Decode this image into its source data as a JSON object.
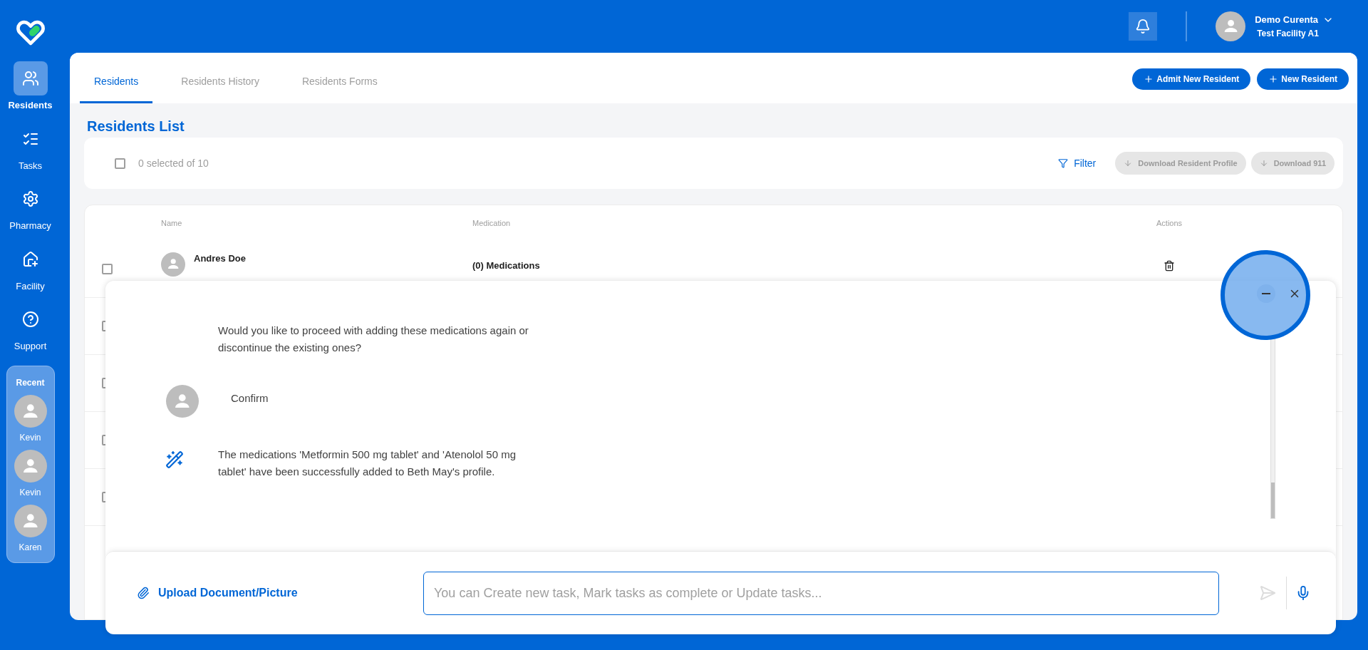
{
  "sidebar": {
    "items": [
      {
        "label": "Residents",
        "selected": true
      },
      {
        "label": "Tasks",
        "selected": false
      },
      {
        "label": "Pharmacy",
        "selected": false
      },
      {
        "label": "Facility",
        "selected": false
      },
      {
        "label": "Support",
        "selected": false
      }
    ],
    "recent": {
      "title": "Recent",
      "people": [
        "Kevin",
        "Kevin",
        "Karen"
      ]
    }
  },
  "header": {
    "user": {
      "name": "Demo Curenta",
      "facility": "Test Facility A1"
    }
  },
  "tabs": [
    {
      "label": "Residents",
      "selected": true
    },
    {
      "label": "Residents History",
      "selected": false
    },
    {
      "label": "Residents Forms",
      "selected": false
    }
  ],
  "actions": [
    "Admit New Resident",
    "New Resident"
  ],
  "list": {
    "title": "Residents List",
    "selection": "0 selected of 10",
    "all_checked": false,
    "filter": "Filter",
    "downloads": [
      {
        "label": "Download Resident Profile",
        "disabled": true
      },
      {
        "label": "Download 911",
        "disabled": true
      }
    ]
  },
  "table": {
    "columns": [
      "Name",
      "Medication",
      "Actions"
    ],
    "rows": [
      {
        "name": "Andres Doe",
        "medication": "(0) Medications",
        "checked": false
      },
      {
        "checked": false
      },
      {
        "checked": false
      },
      {
        "checked": false
      },
      {
        "checked": false
      }
    ]
  },
  "chat": {
    "messages": [
      {
        "kind": "bot",
        "text": "Would you like to proceed with adding these medications again or discontinue the existing ones?"
      },
      {
        "kind": "user",
        "text": "Confirm"
      },
      {
        "kind": "action",
        "text": "The medications 'Metformin 500 mg tablet' and 'Atenolol 50 mg tablet' have been successfully added to Beth May's profile."
      }
    ],
    "upload": "Upload Document/Picture",
    "input": {
      "placeholder": "You can Create new task, Mark tasks as complete or Update tasks..."
    }
  }
}
